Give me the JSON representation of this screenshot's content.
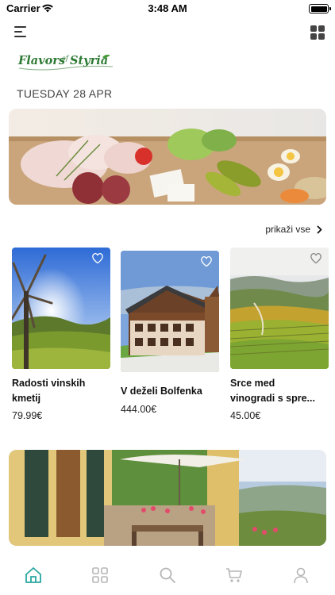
{
  "status_bar": {
    "carrier": "Carrier",
    "time": "3:48 AM"
  },
  "header": {
    "logo_text": "Flavors of Styria",
    "date": "TUESDAY 28 APR"
  },
  "section": {
    "see_all_label": "prikaži vse"
  },
  "products": [
    {
      "title_line1": "Radosti vinskih",
      "title_line2": "kmetij",
      "price": "79.99€"
    },
    {
      "title_line1": "V deželi Bolfenka",
      "title_line2": "",
      "price": "444.00€"
    },
    {
      "title_line1": "Srce med",
      "title_line2": "vinogradi s spre...",
      "price": "45.00€"
    }
  ],
  "tabs": [
    {
      "icon": "home-icon",
      "active": true
    },
    {
      "icon": "categories-icon",
      "active": false
    },
    {
      "icon": "search-icon",
      "active": false
    },
    {
      "icon": "cart-icon",
      "active": false
    },
    {
      "icon": "profile-icon",
      "active": false
    }
  ],
  "colors": {
    "brand_green": "#2e7a34",
    "accent_teal": "#2aa7a0",
    "tab_inactive": "#b5b5b5"
  }
}
